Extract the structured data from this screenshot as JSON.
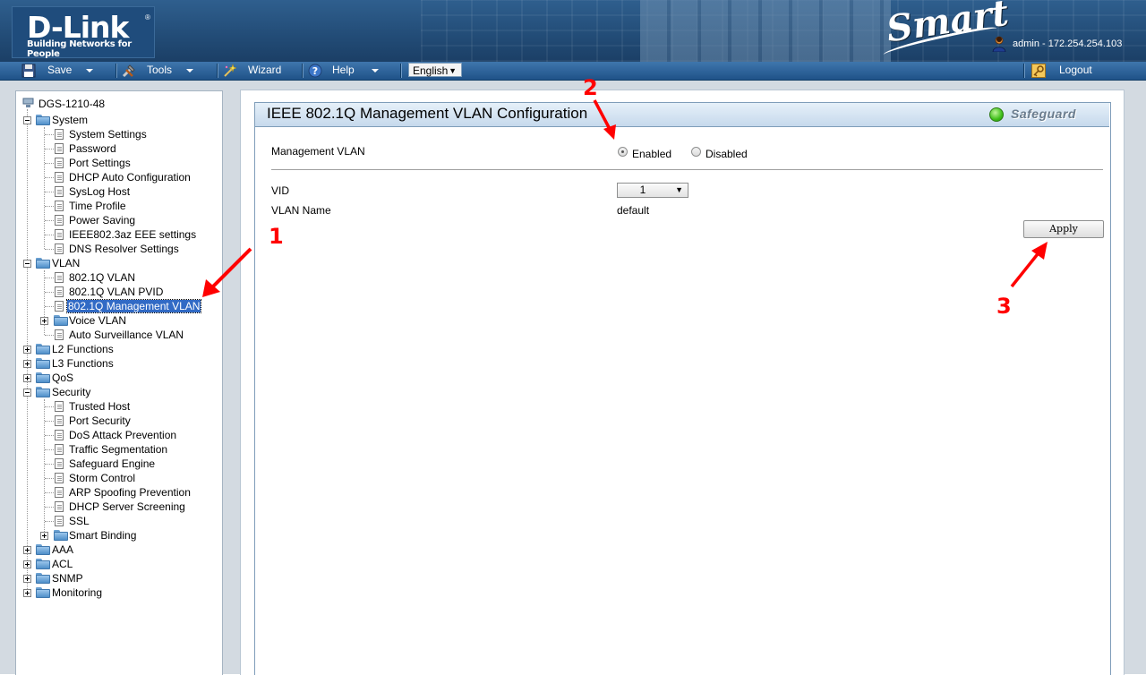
{
  "header": {
    "logo_text": "D-Link",
    "logo_tagline": "Building Networks for People",
    "logo_reg": "®",
    "product_brand": "Smart",
    "user_label": "admin - 172.254.254.103"
  },
  "menubar": {
    "save_label": "Save",
    "tools_label": "Tools",
    "wizard_label": "Wizard",
    "help_label": "Help",
    "language_value": "English",
    "logout_label": "Logout"
  },
  "tree": {
    "root": "DGS-1210-48",
    "items": [
      {
        "label": "System"
      },
      {
        "label": "System Settings"
      },
      {
        "label": "Password"
      },
      {
        "label": "Port Settings"
      },
      {
        "label": "DHCP Auto Configuration"
      },
      {
        "label": "SysLog Host"
      },
      {
        "label": "Time Profile"
      },
      {
        "label": "Power Saving"
      },
      {
        "label": "IEEE802.3az EEE settings"
      },
      {
        "label": "DNS Resolver Settings"
      },
      {
        "label": "VLAN"
      },
      {
        "label": "802.1Q VLAN"
      },
      {
        "label": "802.1Q VLAN PVID"
      },
      {
        "label": "802.1Q Management VLAN"
      },
      {
        "label": "Voice VLAN"
      },
      {
        "label": "Auto Surveillance VLAN"
      },
      {
        "label": "L2 Functions"
      },
      {
        "label": "L3 Functions"
      },
      {
        "label": "QoS"
      },
      {
        "label": "Security"
      },
      {
        "label": "Trusted Host"
      },
      {
        "label": "Port Security"
      },
      {
        "label": "DoS Attack Prevention"
      },
      {
        "label": "Traffic Segmentation"
      },
      {
        "label": "Safeguard Engine"
      },
      {
        "label": "Storm Control"
      },
      {
        "label": "ARP Spoofing Prevention"
      },
      {
        "label": "DHCP Server Screening"
      },
      {
        "label": "SSL"
      },
      {
        "label": "Smart Binding"
      },
      {
        "label": "AAA"
      },
      {
        "label": "ACL"
      },
      {
        "label": "SNMP"
      },
      {
        "label": "Monitoring"
      }
    ]
  },
  "content": {
    "title": "IEEE 802.1Q Management VLAN Configuration",
    "safeguard_label": "Safeguard",
    "management_vlan_label": "Management VLAN",
    "enabled_label": "Enabled",
    "disabled_label": "Disabled",
    "management_vlan_state": "Enabled",
    "vid_label": "VID",
    "vid_value": "1",
    "vlan_name_label": "VLAN Name",
    "vlan_name_value": "default",
    "apply_label": "Apply"
  },
  "annotations": {
    "step1": "1",
    "step2": "2",
    "step3": "3",
    "color": "#ff0000"
  }
}
